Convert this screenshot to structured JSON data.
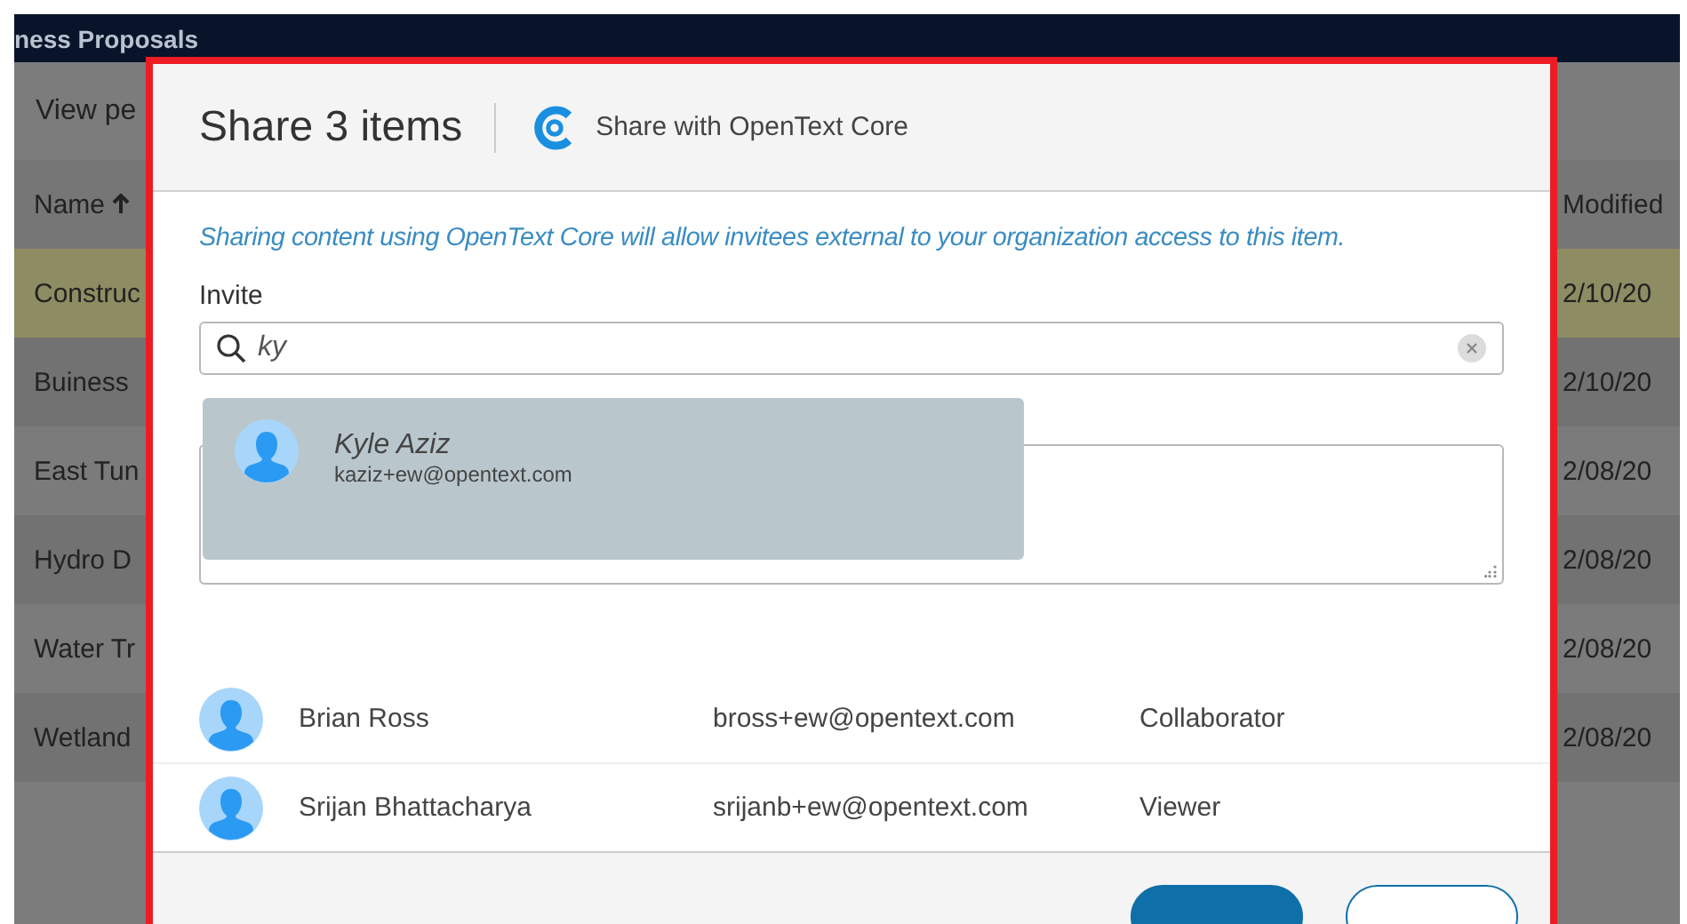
{
  "background": {
    "title": "ness Proposals",
    "toolbar_text": "View pe",
    "columns": [
      {
        "label": "Name",
        "sorted": true
      },
      {
        "label": "Modified",
        "sorted": false
      }
    ],
    "rows": [
      {
        "name": "Construc",
        "modified": "2/10/20",
        "highlighted": true
      },
      {
        "name": "Buiness",
        "modified": "2/10/20",
        "highlighted": false
      },
      {
        "name": "East Tun",
        "modified": "2/08/20",
        "highlighted": false
      },
      {
        "name": "Hydro D",
        "modified": "2/08/20",
        "highlighted": false
      },
      {
        "name": "Water Tr",
        "modified": "2/08/20",
        "highlighted": false
      },
      {
        "name": "Wetland",
        "modified": "2/08/20",
        "highlighted": false
      }
    ]
  },
  "dialog": {
    "title": "Share 3 items",
    "service": "Share with OpenText Core",
    "notice": "Sharing content using OpenText Core will allow invitees external to your organization access to this item.",
    "invite_label": "Invite",
    "search": {
      "value": "ky"
    },
    "suggestions": [
      {
        "name": "Kyle Aziz",
        "email": "kaziz+ew@opentext.com"
      }
    ],
    "people": [
      {
        "name": "Brian Ross",
        "email": "bross+ew@opentext.com",
        "role": "Collaborator"
      },
      {
        "name": "Srijan Bhattacharya",
        "email": "srijanb+ew@opentext.com",
        "role": "Viewer"
      }
    ],
    "buttons": [
      {
        "kind": "primary"
      },
      {
        "kind": "secondary"
      }
    ]
  }
}
